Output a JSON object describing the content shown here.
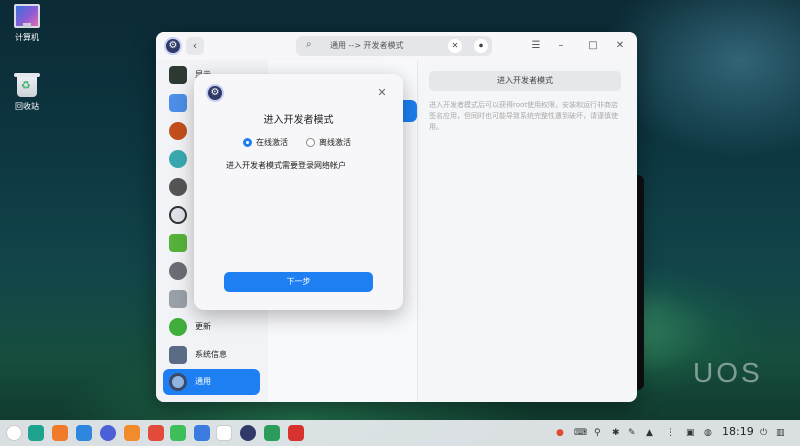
{
  "desktop": {
    "computer_label": "计算机",
    "trash_label": "回收站",
    "watermark": "UOS"
  },
  "window": {
    "search": {
      "text": "通用 --> 开发者模式"
    },
    "sidebar": [
      {
        "label": "显示",
        "icon": "display-icon",
        "color": "#2c3a33"
      },
      {
        "label": "",
        "icon": "notification-icon",
        "color": "#4d8ee8"
      },
      {
        "label": "",
        "icon": "sound-icon",
        "color": "#c24f1c"
      },
      {
        "label": "",
        "icon": "network-icon",
        "color": "#39a9b0"
      },
      {
        "label": "",
        "icon": "bluetooth-icon",
        "color": "#555555"
      },
      {
        "label": "",
        "icon": "clock-icon",
        "color": "#dfe3e9"
      },
      {
        "label": "",
        "icon": "battery-icon",
        "color": "#56b23a"
      },
      {
        "label": "",
        "icon": "mouse-icon",
        "color": "#6a6e74"
      },
      {
        "label": "",
        "icon": "keyboard-icon",
        "color": "#9aa0a8"
      },
      {
        "label": "更新",
        "icon": "update-icon",
        "color": "#3fae3b"
      },
      {
        "label": "系统信息",
        "icon": "system-info-icon",
        "color": "#5a6b86"
      },
      {
        "label": "通用",
        "icon": "general-icon",
        "color": "#8fb4e0"
      }
    ],
    "developer": {
      "button_label": "进入开发者模式",
      "description": "进入开发者模式后可以获得root使用权限，安装和运行非商店签名应用，但同时也可能导致系统完整性遭到破坏，请谨慎使用。"
    }
  },
  "dialog": {
    "title": "进入开发者模式",
    "option_online": "在线激活",
    "option_offline": "离线激活",
    "info": "进入开发者模式需要登录网络帐户",
    "next_label": "下一步"
  },
  "taskbar": {
    "apps": [
      {
        "icon": "launcher-icon",
        "color": "#ffffff"
      },
      {
        "icon": "multitask-icon",
        "color": "#1ea38f"
      },
      {
        "icon": "app-grid-icon",
        "color": "#f07a2a"
      },
      {
        "icon": "file-manager-icon",
        "color": "#2e86de"
      },
      {
        "icon": "browser-icon",
        "color": "#4b5fd6"
      },
      {
        "icon": "app-store-icon",
        "color": "#2d9de0"
      },
      {
        "icon": "archive-icon",
        "color": "#f28b2c"
      },
      {
        "icon": "photos-icon",
        "color": "#e24b3a"
      },
      {
        "icon": "music-icon",
        "color": "#3fbf5a"
      },
      {
        "icon": "document-icon",
        "color": "#3b7be0"
      },
      {
        "icon": "calendar-icon",
        "color": "#ffffff"
      },
      {
        "icon": "control-center-icon",
        "color": "#2f3a69"
      },
      {
        "icon": "download-icon",
        "color": "#2a9d5c"
      },
      {
        "icon": "flag-icon",
        "color": "#d8322e"
      }
    ],
    "clock": "18:19"
  }
}
